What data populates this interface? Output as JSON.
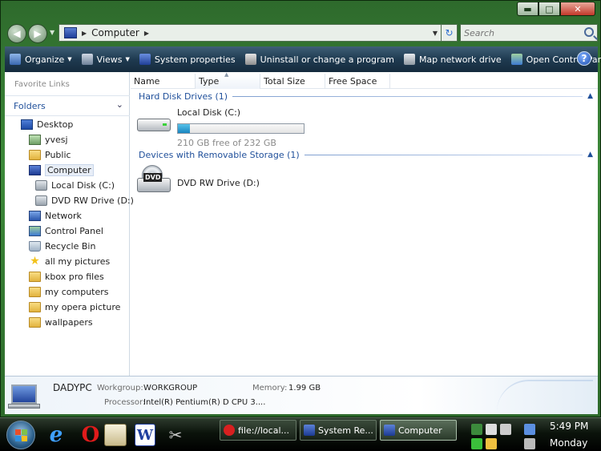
{
  "window": {
    "min_glyph": "▬",
    "max_glyph": "□",
    "close_glyph": "✕"
  },
  "address": {
    "crumb": "Computer",
    "search_placeholder": "Search"
  },
  "toolbar": {
    "items": [
      {
        "label": "Organize",
        "icon": "organize-icon",
        "caret": true
      },
      {
        "label": "Views",
        "icon": "views-icon",
        "caret": true
      },
      {
        "label": "System properties",
        "icon": "system-properties-icon",
        "caret": false
      },
      {
        "label": "Uninstall or change a program",
        "icon": "uninstall-icon",
        "caret": false
      },
      {
        "label": "Map network drive",
        "icon": "map-drive-icon",
        "caret": false
      },
      {
        "label": "Open Control Panel",
        "icon": "control-panel-icon",
        "caret": false
      }
    ],
    "help_glyph": "?"
  },
  "nav": {
    "favorite_links": "Favorite Links",
    "folders": "Folders",
    "tree": [
      {
        "label": "Desktop",
        "icon": "desktop-icon",
        "indent": 0
      },
      {
        "label": "yvesj",
        "icon": "user-folder-icon",
        "indent": 1
      },
      {
        "label": "Public",
        "icon": "folder-icon",
        "indent": 1
      },
      {
        "label": "Computer",
        "icon": "computer-icon",
        "indent": 1,
        "selected": true
      },
      {
        "label": "Local Disk (C:)",
        "icon": "hard-disk-icon",
        "indent": 2
      },
      {
        "label": "DVD RW Drive (D:)",
        "icon": "dvd-drive-icon",
        "indent": 2
      },
      {
        "label": "Network",
        "icon": "network-icon",
        "indent": 1
      },
      {
        "label": "Control Panel",
        "icon": "control-panel-icon",
        "indent": 1
      },
      {
        "label": "Recycle Bin",
        "icon": "recycle-bin-icon",
        "indent": 1
      },
      {
        "label": "all my pictures",
        "icon": "star-folder-icon",
        "indent": 1
      },
      {
        "label": "kbox pro files",
        "icon": "folder-icon",
        "indent": 1
      },
      {
        "label": "my computers",
        "icon": "folder-icon",
        "indent": 1
      },
      {
        "label": "my opera picture",
        "icon": "folder-icon",
        "indent": 1
      },
      {
        "label": "wallpapers",
        "icon": "folder-icon",
        "indent": 1
      }
    ]
  },
  "columns": [
    "Name",
    "Type",
    "Total Size",
    "Free Space"
  ],
  "groups": {
    "hard_disk": "Hard Disk Drives (1)",
    "removable": "Devices with Removable Storage (1)"
  },
  "drives": {
    "local_disk": {
      "name": "Local Disk (C:)",
      "free_text": "210 GB free of 232 GB",
      "used_fraction": 0.095
    },
    "dvd": {
      "name": "DVD RW Drive (D:)",
      "tag": "DVD"
    }
  },
  "details": {
    "pc_name": "DADYPC",
    "workgroup_key": "Workgroup:",
    "workgroup_val": "WORKGROUP",
    "memory_key": "Memory:",
    "memory_val": "1.99 GB",
    "processor_key": "Processor:",
    "processor_val": "Intel(R) Pentium(R) D CPU 3...."
  },
  "taskbar": {
    "quicklaunch": {
      "ie": "e",
      "opera": "O",
      "word": "W",
      "tools": "✂"
    },
    "tasks": [
      {
        "label": "file://local...",
        "icon": "opera-icon"
      },
      {
        "label": "System Re...",
        "icon": "system-icon"
      },
      {
        "label": "Computer",
        "icon": "computer-icon",
        "active": true
      }
    ],
    "clock_time": "5:49 PM",
    "clock_day": "Monday"
  },
  "colors": {
    "frame": "#3d8a3a",
    "toolbar": "#1f3b51",
    "link_blue": "#1f4f9a",
    "progress": "#1a86c1"
  }
}
